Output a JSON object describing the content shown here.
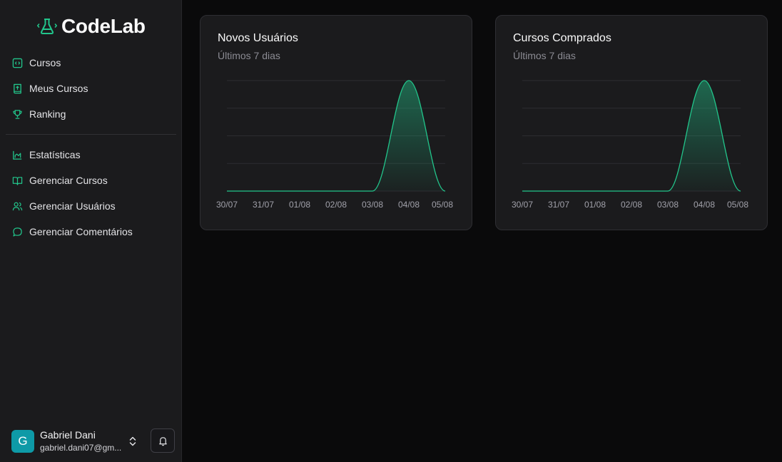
{
  "brand": {
    "name": "CodeLab",
    "icon": "flask-icon",
    "accent": "#22c58b"
  },
  "sidebar": {
    "primary": [
      {
        "label": "Cursos",
        "icon": "code-square-icon"
      },
      {
        "label": "Meus Cursos",
        "icon": "book-upload-icon"
      },
      {
        "label": "Ranking",
        "icon": "trophy-icon"
      }
    ],
    "admin": [
      {
        "label": "Estatísticas",
        "icon": "area-chart-icon"
      },
      {
        "label": "Gerenciar Cursos",
        "icon": "open-book-icon"
      },
      {
        "label": "Gerenciar Usuários",
        "icon": "users-icon"
      },
      {
        "label": "Gerenciar Comentários",
        "icon": "message-circle-icon"
      }
    ]
  },
  "user": {
    "initial": "G",
    "name": "Gabriel Dani",
    "email": "gabriel.dani07@gm..."
  },
  "cards": [
    {
      "title": "Novos Usuários",
      "subtitle": "Últimos 7 dias"
    },
    {
      "title": "Cursos Comprados",
      "subtitle": "Últimos 7 dias"
    }
  ],
  "chart_data": [
    {
      "type": "area",
      "title": "Novos Usuários",
      "subtitle": "Últimos 7 dias",
      "categories": [
        "30/07",
        "31/07",
        "01/08",
        "02/08",
        "03/08",
        "04/08",
        "05/08"
      ],
      "values": [
        0,
        0,
        0,
        0,
        0,
        1,
        0
      ],
      "ylim": [
        0,
        1
      ],
      "grid": true,
      "color": "#22c58b"
    },
    {
      "type": "area",
      "title": "Cursos Comprados",
      "subtitle": "Últimos 7 dias",
      "categories": [
        "30/07",
        "31/07",
        "01/08",
        "02/08",
        "03/08",
        "04/08",
        "05/08"
      ],
      "values": [
        0,
        0,
        0,
        0,
        0,
        1,
        0
      ],
      "ylim": [
        0,
        1
      ],
      "grid": true,
      "color": "#22c58b"
    }
  ]
}
